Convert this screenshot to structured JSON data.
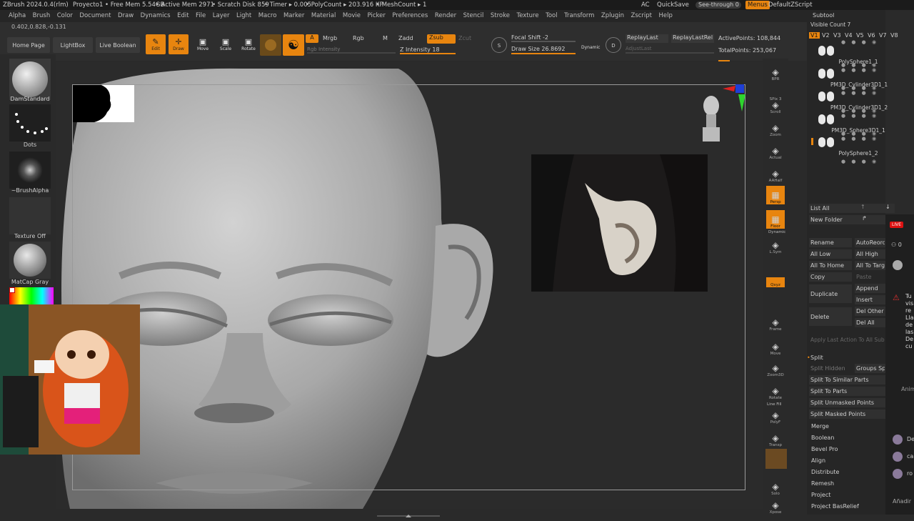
{
  "titlebar": {
    "app": "ZBrush 2024.0.4(rlm)",
    "project": "Proyecto1",
    "free_mem": "• Free Mem 5.54GB",
    "active_mem": "• Active Mem 2971",
    "scratch": "• Scratch Disk 859",
    "timer": "• Timer ▸ 0.005",
    "polycount": "• PolyCount ▸ 203.916 KP",
    "meshcount": "• MeshCount ▸ 1",
    "ac": "AC",
    "quicksave": "QuickSave",
    "seethrough": "See-through",
    "seethrough_val": "0",
    "menus": "Menus",
    "zscript": "DefaultZScript"
  },
  "menu": [
    "Alpha",
    "Brush",
    "Color",
    "Document",
    "Draw",
    "Dynamics",
    "Edit",
    "File",
    "Layer",
    "Light",
    "Macro",
    "Marker",
    "Material",
    "Movie",
    "Picker",
    "Preferences",
    "Render",
    "Stencil",
    "Stroke",
    "Texture",
    "Tool",
    "Transform",
    "Zplugin",
    "Zscript",
    "Help"
  ],
  "coords": "0.402,0.828,-0.131",
  "toolbar": {
    "home": "Home Page",
    "lightbox": "LightBox",
    "liveboolean": "Live Boolean",
    "edit": "Edit",
    "draw": "Draw",
    "move": "Move",
    "scale": "Scale",
    "rotate": "Rotate",
    "a": "A",
    "mrgb": "Mrgb",
    "rgb": "Rgb",
    "m": "M",
    "zadd": "Zadd",
    "zsub": "Zsub",
    "zcut": "Zcut",
    "rgb_intensity": "Rgb Intensity",
    "z_intensity": "Z Intensity 18",
    "focal": "Focal Shift -2",
    "drawsize": "Draw Size 26.8692",
    "dynamic": "Dynamic",
    "replaylast": "ReplayLast",
    "replaylastrel": "ReplayLastRel",
    "adjustlast": "AdjustLast",
    "activepoints": "ActivePoints: 108,844",
    "totalpoints": "TotalPoints: 253,067",
    "s": "S",
    "d": "D"
  },
  "leftshelf": {
    "brush": "DamStandard",
    "stroke": "Dots",
    "alpha": "~BrushAlpha",
    "texture": "Texture Off",
    "material": "MatCap Gray"
  },
  "rightshelf": [
    "BPR",
    "SPix 3",
    "Scroll",
    "Zoom",
    "Actual",
    "AAHalf",
    "Persp",
    "Floor",
    "L.Sym",
    "Qxyz",
    "Frame",
    "Move",
    "Zoom3D",
    "Rotate",
    "PolyF",
    "Transp",
    "Dynamic",
    "Solo",
    "Xpose"
  ],
  "rightshelf_top": {
    "dynamic": "Dynamic",
    "linefill": "Line Fill"
  },
  "subtool": {
    "header": "Subtool",
    "visible_count": "Visible Count 7",
    "versions": [
      "V1",
      "V2",
      "V3",
      "V4",
      "V5",
      "V6",
      "V7",
      "V8"
    ],
    "items": [
      "PolySphere1_1",
      "PM3D_Cylinder3D1_1",
      "PM3D_Cylinder3D1_2",
      "PM3D_Sphere3D1_1",
      "PolySphere1_2"
    ],
    "list_all": "List All",
    "new_folder": "New Folder",
    "actions": {
      "rename": "Rename",
      "autoreorder": "AutoReorder",
      "all_low": "All Low",
      "all_high": "All High",
      "all_to_home": "All To Home",
      "all_to_target": "All To Target",
      "copy": "Copy",
      "paste": "Paste",
      "duplicate": "Duplicate",
      "append": "Append",
      "insert": "Insert",
      "delete": "Delete",
      "del_other": "Del Other",
      "del_all": "Del All",
      "apply_last": "Apply Last Action To All Sub"
    },
    "split_header": "Split",
    "split_hidden": "Split Hidden",
    "groups_split": "Groups Split",
    "split_items": [
      "Split To Similar Parts",
      "Split To Parts",
      "Split Unmasked Points",
      "Split Masked Points"
    ],
    "sections": [
      "Merge",
      "Boolean",
      "Bevel Pro",
      "Align",
      "Distribute",
      "Remesh",
      "Project",
      "Project BasRelief"
    ]
  },
  "tray": {
    "live": "LIVE",
    "viewers": "0",
    "notice": "Tu vis re Lla de las De cu",
    "anim": "Anim",
    "users": [
      "Del",
      "ca",
      "ro"
    ],
    "add": "Añadir"
  }
}
